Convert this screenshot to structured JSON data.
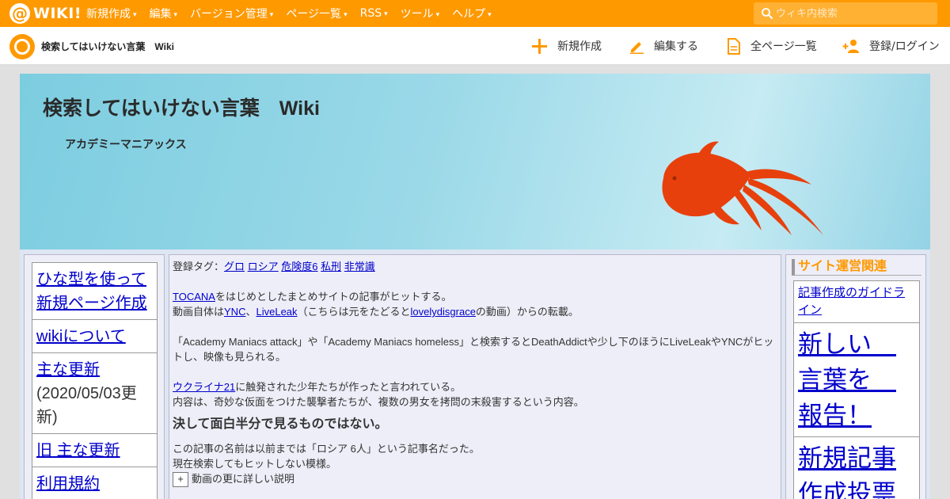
{
  "topbar": {
    "logo_at": "@",
    "logo_text": "WIKI!",
    "menu": [
      {
        "label": "新規作成"
      },
      {
        "label": "編集"
      },
      {
        "label": "バージョン管理"
      },
      {
        "label": "ページ一覧"
      },
      {
        "label": "RSS"
      },
      {
        "label": "ツール"
      },
      {
        "label": "ヘルプ"
      }
    ],
    "caret": "▾",
    "search_placeholder": "ウィキ内検索"
  },
  "subbar": {
    "site_name": "検索してはいけない言葉　Wiki",
    "actions": [
      {
        "label": "新規作成",
        "icon": "plus-icon"
      },
      {
        "label": "編集する",
        "icon": "pencil-icon"
      },
      {
        "label": "全ページ一覧",
        "icon": "document-icon"
      },
      {
        "label": "登録/ログイン",
        "icon": "user-add-icon"
      }
    ]
  },
  "banner": {
    "title": "検索してはいけない言葉　Wiki",
    "subtitle": "アカデミーマニアックス"
  },
  "left_nav": {
    "items": [
      {
        "link": "ひな型を使って新規ページ作成",
        "note": ""
      },
      {
        "link": "wikiについて",
        "note": ""
      },
      {
        "link": "主な更新",
        "note": "(2020/05/03更新)"
      },
      {
        "link": "旧 主な更新",
        "note": ""
      },
      {
        "link": "利用規約",
        "note": ""
      }
    ]
  },
  "main": {
    "tags_label": "登録タグ：",
    "tags": [
      "グロ",
      "ロシア",
      "危険度6",
      "私刑",
      "非常識"
    ],
    "p1_link": "TOCANA",
    "p1_text": "をはじめとしたまとめサイトの記事がヒットする。",
    "p2_prefix": "動画自体は",
    "p2_link1": "YNC",
    "p2_sep": "、",
    "p2_link2": "LiveLeak",
    "p2_mid": "（こちらは元をたどると",
    "p2_link3": "lovelydisgrace",
    "p2_suffix": "の動画）からの転載。",
    "p3": "「Academy Maniacs attack」や「Academy Maniacs homeless」と検索するとDeathAddictや少し下のほうにLiveLeakやYNCがヒットし、映像も見られる。",
    "p4_link": "ウクライナ21",
    "p4_text": "に触発された少年たちが作ったと言われている。",
    "p5": "内容は、奇妙な仮面をつけた襲撃者たちが、複数の男女を拷問の末殺害するという内容。",
    "bold": "決して面白半分で見るものではない。",
    "p6": "この記事の名前は以前までは「ロシア 6人」という記事名だった。",
    "p7": "現在検索してもヒットしない模様。",
    "expand_symbol": "+",
    "expand_label": "動画の更に詳しい説明"
  },
  "right_nav": {
    "heading": "サイト運営関連",
    "items": [
      {
        "label": "記事作成のガイドライン",
        "size": "small"
      },
      {
        "label": "新しい　言葉を　報告！",
        "size": "big"
      },
      {
        "label": "新規記事作成投票",
        "size": "big"
      }
    ]
  },
  "colors": {
    "accent": "#ff9900",
    "link": "#0000cc",
    "fish": "#e8400c"
  }
}
